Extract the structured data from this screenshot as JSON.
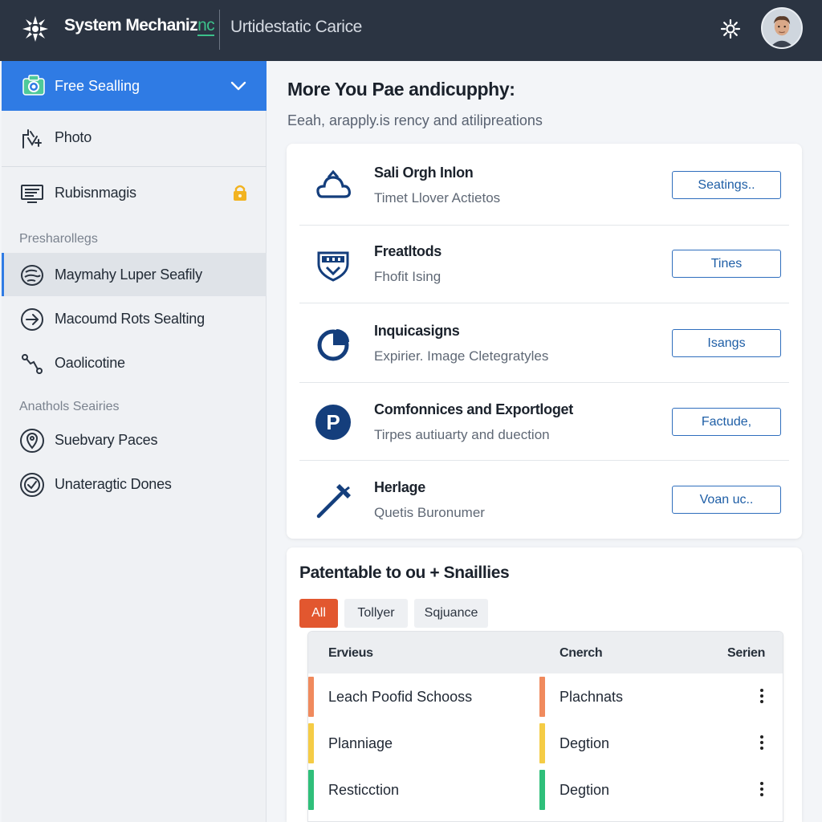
{
  "header": {
    "brand_main": "System Mechaniz",
    "brand_accent": "nc",
    "subtitle": "Urtidestatic Carice"
  },
  "sidebar": {
    "active_item": "Free Sealling",
    "items_top": [
      {
        "label": "Photo"
      },
      {
        "label": "Rubisnmagis"
      }
    ],
    "section1": "Presharollegs",
    "items_mid": [
      {
        "label": "Maymahy Luper Seafily"
      },
      {
        "label": "Macoumd Rots Sealting"
      },
      {
        "label": "Oaolicotine"
      }
    ],
    "section2": "Anathols Seairies",
    "items_bottom": [
      {
        "label": "Suebvary Paces"
      },
      {
        "label": "Unateragtic Dones"
      }
    ]
  },
  "main": {
    "title": "More You Pae andicupphy:",
    "subtitle": "Eeah, arapply.is rency and atilipreations",
    "services": [
      {
        "title": "Sali Orgh Inlon",
        "subtitle": "Timet Llover Actietos",
        "button": "Seatings..",
        "icon": "cloud-icon"
      },
      {
        "title": "Freatltods",
        "subtitle": "Fhofit Ising",
        "button": "Tines",
        "icon": "shield-icon"
      },
      {
        "title": "Inquicasigns",
        "subtitle": "Expirier. Image Cletegratyles",
        "button": "Isangs",
        "icon": "pie-chart-icon"
      },
      {
        "title": "Comfonnices and Exportloget",
        "subtitle": "Tirpes autiuarty and duection",
        "button": "Factude,",
        "icon": "parking-icon"
      },
      {
        "title": "Herlage",
        "subtitle": "Quetis Buronumer",
        "button": "Voan uc..",
        "icon": "hammer-icon"
      }
    ],
    "section_title": "Patentable to ou + Snaillies",
    "filters": [
      "All",
      "Tollyer",
      "Sqjuance"
    ],
    "table": {
      "headers": [
        "Ervieus",
        "Cnerch",
        "Serien"
      ],
      "rows": [
        {
          "name": "Leach Poofid Schooss",
          "status": "Plachnats",
          "color": "#f08a5d"
        },
        {
          "name": "Planniage",
          "status": "Degtion",
          "color": "#f5cc45"
        },
        {
          "name": "Resticction",
          "status": "Degtion",
          "color": "#2fbf7a"
        }
      ]
    }
  }
}
